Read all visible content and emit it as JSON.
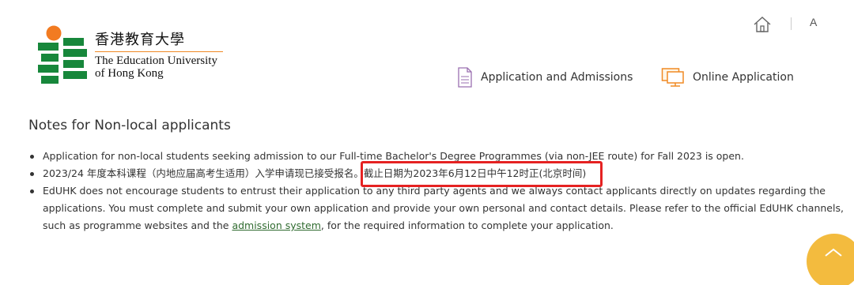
{
  "logo": {
    "chinese_name": "香港教育大學",
    "english_line1": "The Education University",
    "english_line2": "of Hong Kong",
    "colors": {
      "green": "#17873b",
      "orange": "#f27b21"
    }
  },
  "utility": {
    "home_icon": "home-icon",
    "lang_label": "A"
  },
  "nav": {
    "applications_label": "Application and Admissions",
    "applications_icon": "document-icon",
    "online_label": "Online Application",
    "online_icon": "monitor-icon"
  },
  "content": {
    "title": "Notes for Non-local applicants",
    "note1": "Application for non-local students seeking admission to our Full-time Bachelor's Degree Programmes (via non-JEE route) for Fall 2023 is open.",
    "note2_prefix": "2023/24 年度本科课程（内地应届高考生适用）入学申请现已接受报名",
    "note2_deadline": "。截止日期为2023年6月12日中午12时正(北京时间)",
    "note3_part1": "EdUHK does not encourage students to entrust their application to any third party agents and we always contact applicants directly on updates regarding the applications. You must complete and submit your own application and provide your own personal and contact details. Please refer to the official EdUHK channels, such as programme websites and the ",
    "note3_link": "admission system",
    "note3_part2": ", for the required information to complete your application.",
    "highlight_color": "#e52222",
    "link_color": "#2f6b2f"
  },
  "back_to_top": {
    "icon": "chevron-up-icon",
    "color": "#f3bb3e"
  }
}
